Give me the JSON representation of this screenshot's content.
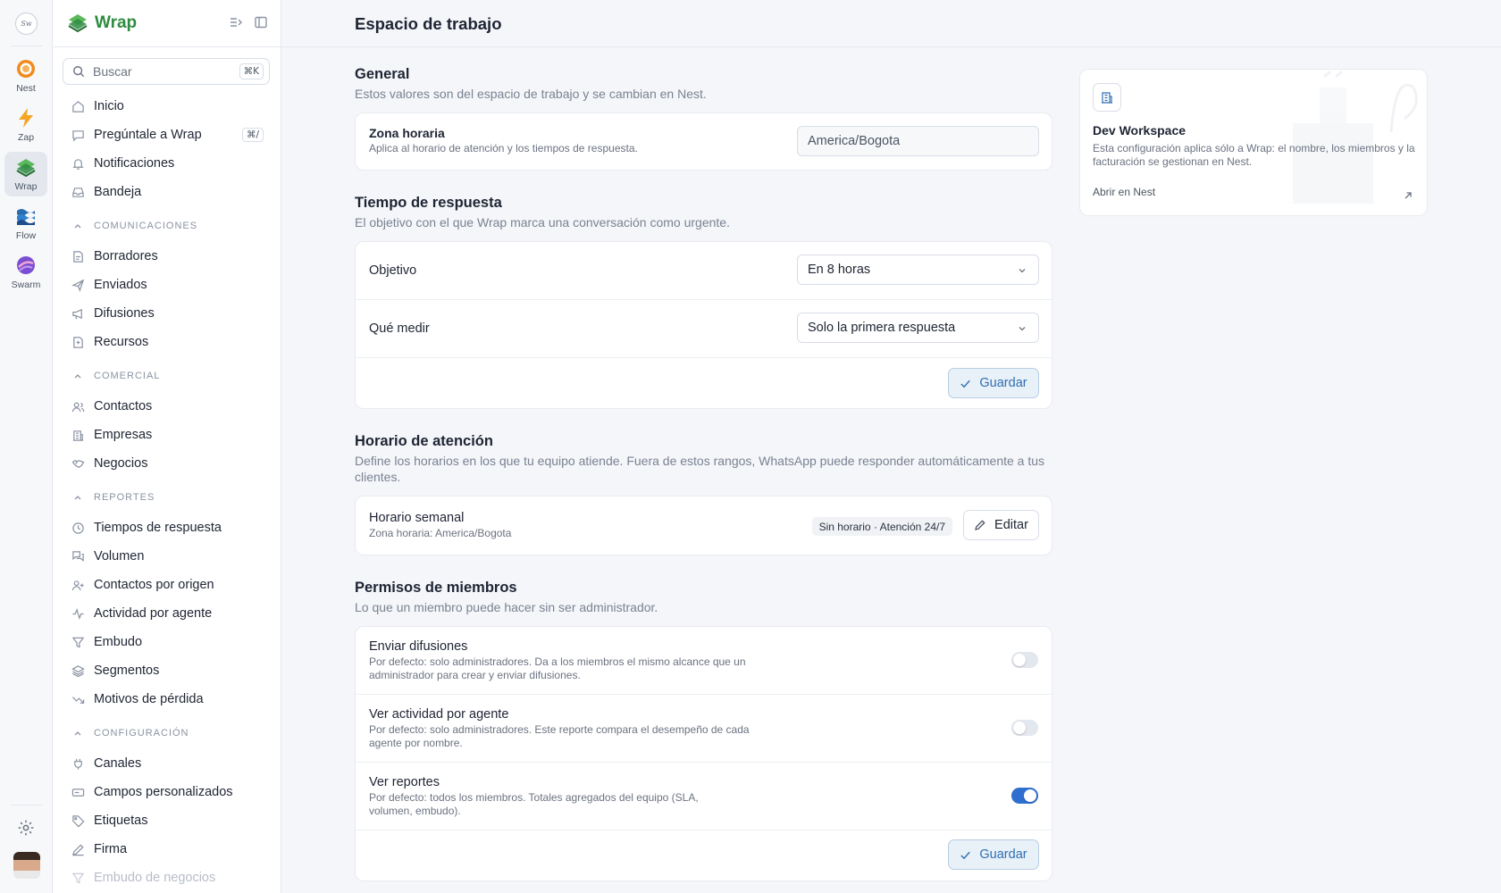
{
  "rail": {
    "apps": [
      {
        "label": "Nest",
        "icon": "nest-icon"
      },
      {
        "label": "Zap",
        "icon": "zap-icon"
      },
      {
        "label": "Wrap",
        "icon": "wrap-icon",
        "active": true
      },
      {
        "label": "Flow",
        "icon": "flow-icon"
      },
      {
        "label": "Swarm",
        "icon": "swarm-icon"
      }
    ]
  },
  "sidebar": {
    "brand": "Wrap",
    "search": {
      "placeholder": "Buscar",
      "shortcut": "⌘K"
    },
    "top_items": [
      {
        "label": "Inicio",
        "icon": "home-icon"
      },
      {
        "label": "Pregúntale a Wrap",
        "icon": "chat-icon",
        "shortcut": "⌘/"
      },
      {
        "label": "Notificaciones",
        "icon": "bell-icon"
      },
      {
        "label": "Bandeja",
        "icon": "inbox-icon"
      }
    ],
    "sections": [
      {
        "title": "COMUNICACIONES",
        "items": [
          "Borradores",
          "Enviados",
          "Difusiones",
          "Recursos"
        ]
      },
      {
        "title": "COMERCIAL",
        "items": [
          "Contactos",
          "Empresas",
          "Negocios"
        ]
      },
      {
        "title": "REPORTES",
        "items": [
          "Tiempos de respuesta",
          "Volumen",
          "Contactos por origen",
          "Actividad por agente",
          "Embudo",
          "Segmentos",
          "Motivos de pérdida"
        ]
      },
      {
        "title": "CONFIGURACIÓN",
        "items": [
          "Canales",
          "Campos personalizados",
          "Etiquetas",
          "Firma",
          "Embudo de negocios"
        ]
      }
    ]
  },
  "header": {
    "title": "Espacio de trabajo"
  },
  "general": {
    "title": "General",
    "subtitle": "Estos valores son del espacio de trabajo y se cambian en Nest.",
    "timezone": {
      "label": "Zona horaria",
      "desc": "Aplica al horario de atención y los tiempos de respuesta.",
      "value": "America/Bogota"
    }
  },
  "response": {
    "title": "Tiempo de respuesta",
    "subtitle": "El objetivo con el que Wrap marca una conversación como urgente.",
    "goal": {
      "label": "Objetivo",
      "value": "En 8 horas"
    },
    "measure": {
      "label": "Qué medir",
      "value": "Solo la primera respuesta"
    },
    "save_label": "Guardar"
  },
  "hours": {
    "title": "Horario de atención",
    "subtitle": "Define los horarios en los que tu equipo atiende. Fuera de estos rangos, WhatsApp puede responder automáticamente a tus clientes.",
    "weekly": {
      "label": "Horario semanal",
      "desc": "Zona horaria: America/Bogota",
      "badge": "Sin horario · Atención 24/7",
      "edit_label": "Editar"
    }
  },
  "permissions": {
    "title": "Permisos de miembros",
    "subtitle": "Lo que un miembro puede hacer sin ser administrador.",
    "items": [
      {
        "label": "Enviar difusiones",
        "desc": "Por defecto: solo administradores. Da a los miembros el mismo alcance que un administrador para crear y enviar difusiones.",
        "enabled": false
      },
      {
        "label": "Ver actividad por agente",
        "desc": "Por defecto: solo administradores. Este reporte compara el desempeño de cada agente por nombre.",
        "enabled": false
      },
      {
        "label": "Ver reportes",
        "desc": "Por defecto: todos los miembros. Totales agregados del equipo (SLA, volumen, embudo).",
        "enabled": true
      }
    ],
    "save_label": "Guardar"
  },
  "workspace_card": {
    "title": "Dev Workspace",
    "desc": "Esta configuración aplica sólo a Wrap: el nombre, los miembros y la facturación se gestionan en Nest.",
    "link": "Abrir en Nest"
  },
  "colors": {
    "accent": "#2f6fd0",
    "brand": "#2e8b3f"
  }
}
